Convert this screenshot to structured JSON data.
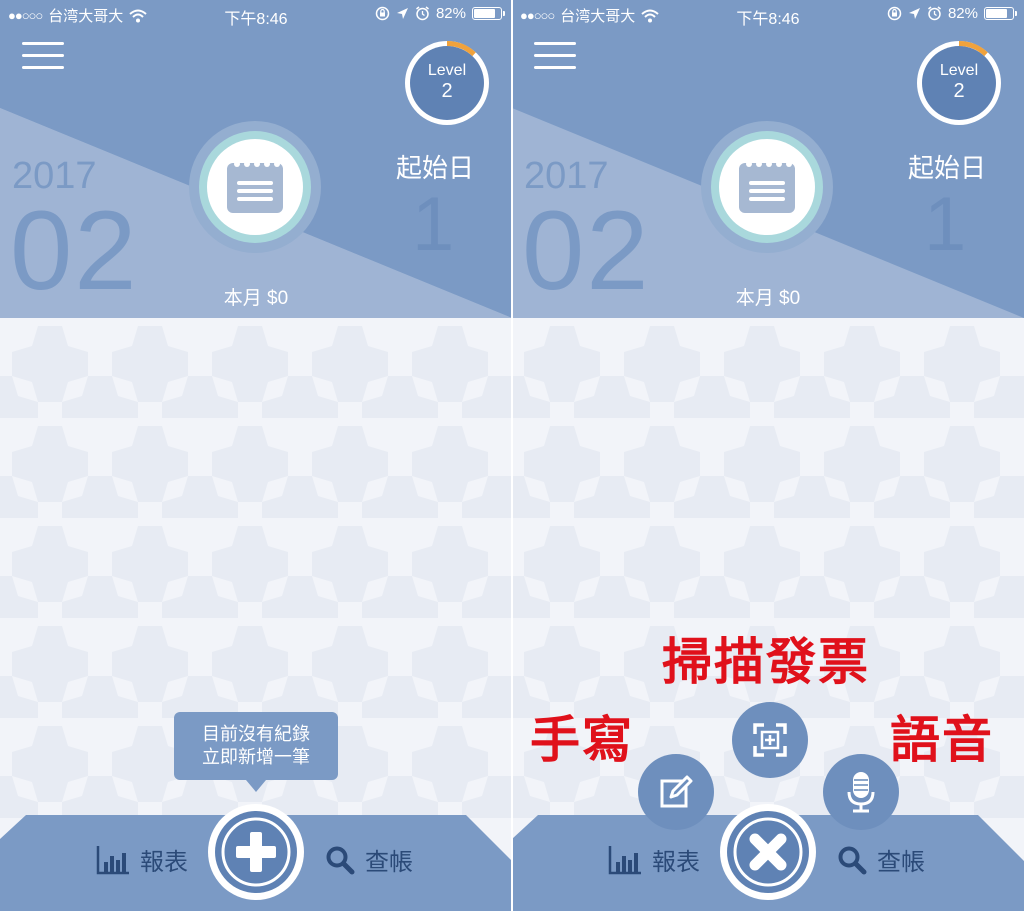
{
  "status_bar": {
    "carrier": "台湾大哥大",
    "signal_dots": "●●○○○",
    "time": "下午8:46",
    "battery_percent": "82%",
    "battery_level": 0.82
  },
  "header": {
    "level_label": "Level",
    "level_value": "2",
    "level_progress": 0.12,
    "year": "2017",
    "month": "02",
    "start_label": "起始日",
    "start_day": "1",
    "month_total": "本月 $0"
  },
  "empty_tooltip": {
    "line1": "目前沒有紀錄",
    "line2": "立即新增一筆"
  },
  "tabbar": {
    "report_label": "報表",
    "query_label": "查帳"
  },
  "quick_add_labels": {
    "scan": "掃描發票",
    "handwrite": "手寫",
    "voice": "語音"
  },
  "colors": {
    "header_blue": "#7b9ac5",
    "header_light": "#9fb4d4",
    "accent_orange": "#f0a23c",
    "annotation_red": "#e0111b",
    "tab_text": "#2b4a78"
  }
}
